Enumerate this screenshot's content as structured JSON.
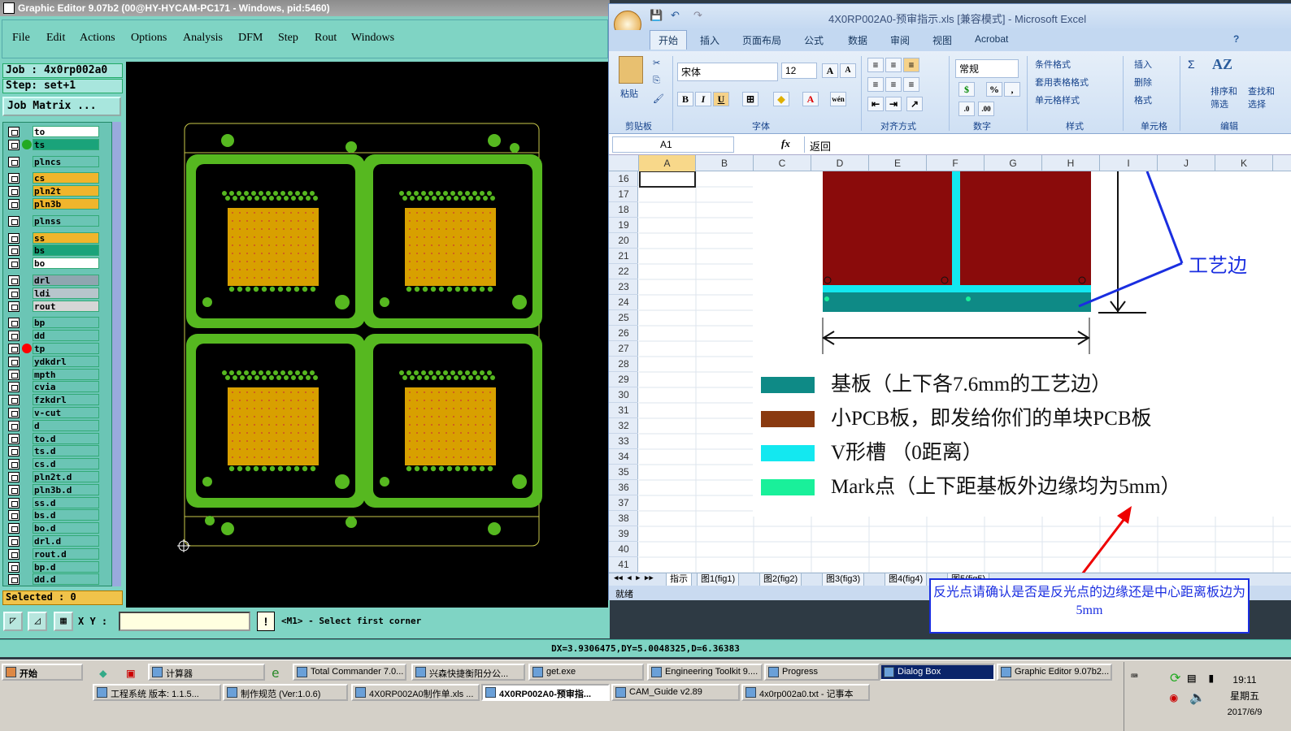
{
  "graphic_editor": {
    "title": "Graphic Editor 9.07b2 (00@HY-HYCAM-PC171 - Windows, pid:5460)",
    "menu": [
      "File",
      "Edit",
      "Actions",
      "Options",
      "Analysis",
      "DFM",
      "Step",
      "Rout",
      "Windows"
    ],
    "job": "Job : 4x0rp002a0",
    "step": "Step: set+1",
    "job_matrix_button": "Job Matrix ...",
    "layers": [
      {
        "name": "to",
        "color": "#ffffff"
      },
      {
        "name": "ts",
        "color": "#1aa37a"
      },
      {
        "name": "plncs",
        "color": "#6bc5b5"
      },
      {
        "name": "cs",
        "color": "#f0b52c"
      },
      {
        "name": "pln2t",
        "color": "#f0b52c"
      },
      {
        "name": "pln3b",
        "color": "#f0b52c"
      },
      {
        "name": "plnss",
        "color": "#6bc5b5"
      },
      {
        "name": "ss",
        "color": "#f0b52c"
      },
      {
        "name": "bs",
        "color": "#1aa37a"
      },
      {
        "name": "bo",
        "color": "#ffffff"
      },
      {
        "name": "drl",
        "color": "#8fa6b0"
      },
      {
        "name": "ldi",
        "color": "#b7c5cc"
      },
      {
        "name": "rout",
        "color": "#d6d6d6"
      },
      {
        "name": "bp",
        "color": "#6bc5b5"
      },
      {
        "name": "dd",
        "color": "#6bc5b5"
      },
      {
        "name": "tp",
        "color": "#6bc5b5"
      },
      {
        "name": "ydkdrl",
        "color": "#6bc5b5"
      },
      {
        "name": "mpth",
        "color": "#6bc5b5"
      },
      {
        "name": "cvia",
        "color": "#6bc5b5"
      },
      {
        "name": "fzkdrl",
        "color": "#6bc5b5"
      },
      {
        "name": "v-cut",
        "color": "#6bc5b5"
      },
      {
        "name": "d",
        "color": "#6bc5b5"
      },
      {
        "name": "to.d",
        "color": "#6bc5b5"
      },
      {
        "name": "ts.d",
        "color": "#6bc5b5"
      },
      {
        "name": "cs.d",
        "color": "#6bc5b5"
      },
      {
        "name": "pln2t.d",
        "color": "#6bc5b5"
      },
      {
        "name": "pln3b.d",
        "color": "#6bc5b5"
      },
      {
        "name": "ss.d",
        "color": "#6bc5b5"
      },
      {
        "name": "bs.d",
        "color": "#6bc5b5"
      },
      {
        "name": "bo.d",
        "color": "#6bc5b5"
      },
      {
        "name": "drl.d",
        "color": "#6bc5b5"
      },
      {
        "name": "rout.d",
        "color": "#6bc5b5"
      },
      {
        "name": "bp.d",
        "color": "#6bc5b5"
      },
      {
        "name": "dd.d",
        "color": "#6bc5b5"
      }
    ],
    "selected": "Selected : 0",
    "xy_label": "X Y :",
    "xy_value": "",
    "prompt_icon": "!",
    "prompt": "<M1> - Select first corner",
    "coords": "DX=3.9306475,DY=5.0048325,D=6.36383"
  },
  "excel": {
    "title": "4X0RP002A0-预审指示.xls [兼容模式] - Microsoft Excel",
    "tabs": [
      "开始",
      "插入",
      "页面布局",
      "公式",
      "数据",
      "审阅",
      "视图",
      "Acrobat"
    ],
    "ribbon": {
      "paste": "粘贴",
      "font_name": "宋体",
      "font_size": "12",
      "number_format": "常规",
      "styles": [
        "条件格式",
        "套用表格格式",
        "单元格样式"
      ],
      "cells": [
        "插入",
        "删除",
        "格式"
      ],
      "edit": [
        "排序和筛选",
        "查找和选择"
      ],
      "group_labels": [
        "剪贴板",
        "字体",
        "对齐方式",
        "数字",
        "样式",
        "单元格",
        "编辑"
      ]
    },
    "name_box": "A1",
    "fx": "fx",
    "formula": "返回",
    "columns": [
      "A",
      "B",
      "C",
      "D",
      "E",
      "F",
      "G",
      "H",
      "I",
      "J",
      "K"
    ],
    "rows": [
      "16",
      "17",
      "18",
      "19",
      "20",
      "21",
      "22",
      "23",
      "24",
      "25",
      "26",
      "27",
      "28",
      "29",
      "30",
      "31",
      "32",
      "33",
      "34",
      "35",
      "36",
      "37",
      "38",
      "39",
      "40",
      "41"
    ],
    "diagram_label": "工艺边",
    "legend": [
      {
        "color": "#0e8a86",
        "text": "基板（上下各7.6mm的工艺边）"
      },
      {
        "color": "#8a3a10",
        "text": "小PCB板，即发给你们的单块PCB板"
      },
      {
        "color": "#13e8f0",
        "text": "V形槽 （0距离）"
      },
      {
        "color": "#19f09a",
        "text": "Mark点（上下距基板外边缘均为5mm）"
      }
    ],
    "sheets": [
      "指示",
      "图1(fig1)",
      "图2(fig2)",
      "图3(fig3)",
      "图4(fig4)",
      "图5(fig5)"
    ],
    "status": "就绪"
  },
  "annotation": "反光点请确认是否是反光点的边缘还是中心距离板边为5mm",
  "taskbar": {
    "start": "开始",
    "row1": [
      "计算器",
      "Total Commander 7.0...",
      "兴森快捷衡阳分公...",
      "get.exe",
      "Engineering Toolkit 9....",
      "Progress",
      "Dialog Box",
      "Graphic Editor 9.07b2..."
    ],
    "row2": [
      "工程系统  版本: 1.1.5...",
      "制作规范 (Ver:1.0.6)",
      "4X0RP002A0制作单.xls ...",
      "4X0RP002A0-预审指...",
      "CAM_Guide v2.89",
      "4x0rp002a0.txt - 记事本"
    ],
    "time": "19:11",
    "weekday": "星期五",
    "date": "2017/6/9"
  }
}
